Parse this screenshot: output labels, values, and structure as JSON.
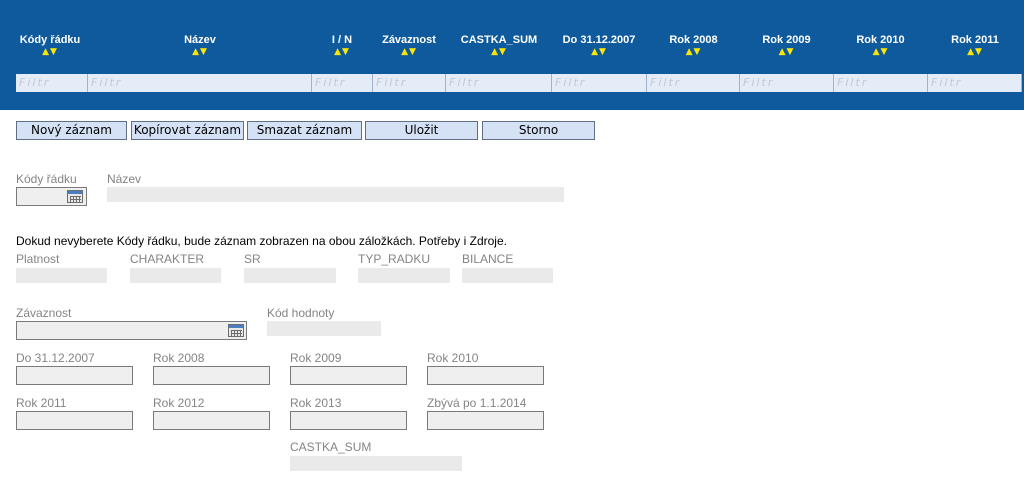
{
  "grid": {
    "columns": [
      {
        "label": "Kódy řádku",
        "sort": "▲▼"
      },
      {
        "label": "Název",
        "sort": "▲▼"
      },
      {
        "label": "I / N",
        "sort": "▲▼"
      },
      {
        "label": "Závaznost",
        "sort": "▲▼"
      },
      {
        "label": "CASTKA_SUM",
        "sort": "▲▼"
      },
      {
        "label": "Do 31.12.2007",
        "sort": "▲▼"
      },
      {
        "label": "Rok 2008",
        "sort": "▲▼"
      },
      {
        "label": "Rok 2009",
        "sort": "▲▼"
      },
      {
        "label": "Rok 2010",
        "sort": "▲▼"
      },
      {
        "label": "Rok 2011",
        "sort": "▲▼"
      }
    ],
    "filter_placeholder": "Filtr"
  },
  "toolbar": {
    "new": "Nový záznam",
    "copy": "Kopírovat záznam",
    "delete": "Smazat záznam",
    "save": "Uložit",
    "cancel": "Storno"
  },
  "form": {
    "kody_radku_label": "Kódy řádku",
    "nazev_label": "Název",
    "note": "Dokud nevyberete Kódy řádku, bude záznam zobrazen na obou záložkách. Potřeby i Zdroje.",
    "platnost_label": "Platnost",
    "charakter_label": "CHARAKTER",
    "sr_label": "SR",
    "typ_radku_label": "TYP_RADKU",
    "bilance_label": "BILANCE",
    "zavaznost_label": "Závaznost",
    "kod_hodnoty_label": "Kód hodnoty",
    "do2007_label": "Do 31.12.2007",
    "rok2008_label": "Rok 2008",
    "rok2009_label": "Rok 2009",
    "rok2010_label": "Rok 2010",
    "rok2011_label": "Rok 2011",
    "rok2012_label": "Rok 2012",
    "rok2013_label": "Rok 2013",
    "zbyva_label": "Zbývá po 1.1.2014",
    "castka_sum_label": "CASTKA_SUM"
  },
  "icons": {
    "calendar": "calendar-icon",
    "sort": "sort-arrows-icon"
  },
  "colors": {
    "header_bg": "#0f5a9c",
    "sort_arrow": "#ffe600",
    "button_bg": "#d5e2f5",
    "filter_bg": "#e3ecf7"
  }
}
